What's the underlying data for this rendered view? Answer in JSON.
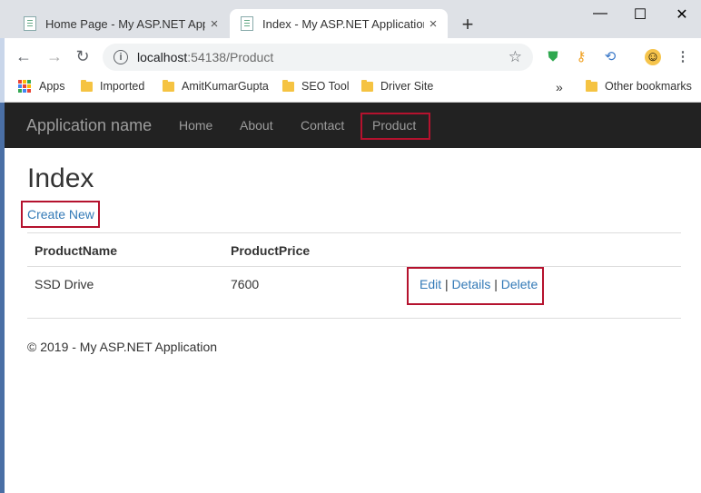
{
  "browser": {
    "tabs": [
      {
        "title": "Home Page - My ASP.NET Applic",
        "close": "×"
      },
      {
        "title": "Index - My ASP.NET Application",
        "close": "×"
      }
    ],
    "new_tab": "+",
    "window": {
      "minimize": "—",
      "maximize": "☐",
      "close": "✕"
    },
    "url_host": "localhost",
    "url_path": ":54138/Product",
    "nav": {
      "back": "←",
      "forward": "→",
      "reload": "↻"
    },
    "bookmarks": [
      "Apps",
      "Imported",
      "AmitKumarGupta",
      "SEO Tool",
      "Driver Site"
    ],
    "more_bookmarks": "»",
    "other_bookmarks": "Other bookmarks",
    "menu": "⋮"
  },
  "site": {
    "brand": "Application name",
    "nav": [
      "Home",
      "About",
      "Contact",
      "Product"
    ],
    "page_title": "Index",
    "create_link": "Create New",
    "table": {
      "headers": [
        "ProductName",
        "ProductPrice"
      ],
      "rows": [
        {
          "name": "SSD Drive",
          "price": "7600",
          "edit": "Edit",
          "details": "Details",
          "delete": "Delete",
          "sep": "|"
        }
      ]
    },
    "footer": "© 2019 - My ASP.NET Application"
  },
  "colors": {
    "highlight": "#b5122e",
    "link": "#337ab7",
    "navbar": "#222222"
  }
}
